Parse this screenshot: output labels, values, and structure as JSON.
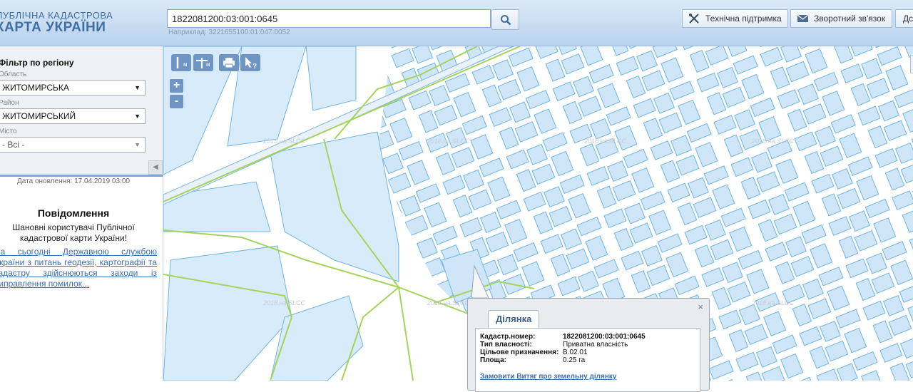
{
  "header": {
    "logo_line1": "ПУБЛІЧНА КАДАСТРОВА",
    "logo_line2": "КАРТА УКРАЇНИ",
    "search_value": "1822081200:03:001:0645",
    "search_hint": "Наприклад: 3221655100:01:047:0052",
    "support_label": "Технічна підтримка",
    "feedback_label": "Зворотний зв'язок",
    "extra_label": "Дс"
  },
  "sidebar": {
    "filter_title": "Фільтр по регіону",
    "region_label": "Область",
    "region_value": "ЖИТОМИРСЬКА",
    "district_label": "Район",
    "district_value": "ЖИТОМИРСЬКИЙ",
    "city_label": "Місто",
    "city_value": "- Всі -",
    "updated": "Дата оновлення: 17.04.2019 03:00",
    "news_title": "Повідомлення",
    "news_greeting": "Шановні користувачі Публічної кадастрової карти України!",
    "news_link": "На сьогодні Державною службою України з питань геодезії, картографії та кадастру здійснюються заходи із виправлення помилок..."
  },
  "map": {
    "tool_labels": [
      "м",
      "м"
    ],
    "zoom_in": "+",
    "zoom_out": "-",
    "watermark": "2018.на.SLCC"
  },
  "popup": {
    "tab_label": "Ділянка",
    "rows": [
      {
        "key": "Кадастр.номер:",
        "value": "1822081200:03:001:0645"
      },
      {
        "key": "Тип власності:",
        "value": "Приватна власність"
      },
      {
        "key": "Цільове призначення:",
        "value": "В.02.01"
      },
      {
        "key": "Площа:",
        "value": "0.25 га"
      }
    ],
    "order_link": "Замовити Витяг про земельну ділянку",
    "close": "×"
  },
  "colors": {
    "parcel_fill": "#cfe6f9",
    "parcel_stroke": "#6fb4e6",
    "boundary": "#a3d45a",
    "accent": "#6e95c4"
  }
}
